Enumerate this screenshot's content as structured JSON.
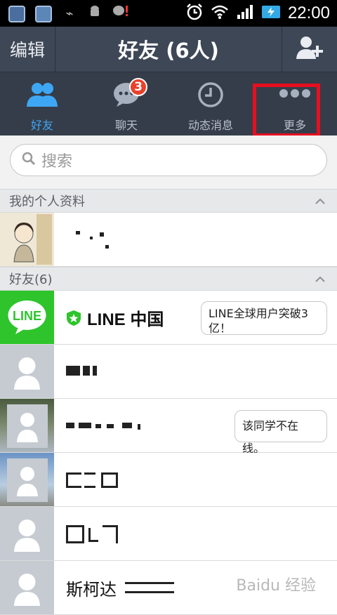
{
  "status_bar": {
    "time": "22:00"
  },
  "header": {
    "edit_label": "编辑",
    "title": "好友 (6人)"
  },
  "tabs": [
    {
      "label": "好友",
      "active": true,
      "icon": "friends-icon"
    },
    {
      "label": "聊天",
      "badge": "3",
      "icon": "chat-icon"
    },
    {
      "label": "动态消息",
      "icon": "clock-icon"
    },
    {
      "label": "更多",
      "icon": "more-dots-icon"
    }
  ],
  "search": {
    "placeholder": "搜索"
  },
  "sections": {
    "profile": "我的个人资料",
    "friends": "好友(6)"
  },
  "friends": [
    {
      "name": "LINE 中国",
      "status": "LINE全球用户突破3亿！"
    },
    {
      "name": ""
    },
    {
      "name": "",
      "status": "该同学不在线。"
    },
    {
      "name": ""
    },
    {
      "name": ""
    },
    {
      "name": "斯柯达"
    }
  ],
  "watermark": "Baidu 经验",
  "colors": {
    "header": "#3e4756",
    "tabbar": "#353d4a",
    "active": "#3ea7f5",
    "badge": "#e8412c",
    "line_green": "#2fc42c",
    "highlight": "#e60f1f"
  }
}
